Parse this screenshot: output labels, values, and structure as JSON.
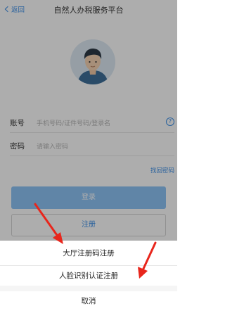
{
  "nav": {
    "back_label": "返回",
    "title": "自然人办税服务平台"
  },
  "form": {
    "account_label": "账号",
    "account_placeholder": "手机号码/证件号码/登录名",
    "password_label": "密码",
    "password_placeholder": "请输入密码",
    "help_glyph": "?",
    "forgot_label": "找回密码"
  },
  "buttons": {
    "login_label": "登录",
    "register_label": "注册"
  },
  "action_sheet": {
    "items": [
      {
        "label": "大厅注册码注册"
      },
      {
        "label": "人脸识别认证注册"
      },
      {
        "label": "取消"
      }
    ]
  },
  "colors": {
    "accent": "#3b8fe8",
    "annotation_arrow": "#e8261c"
  }
}
